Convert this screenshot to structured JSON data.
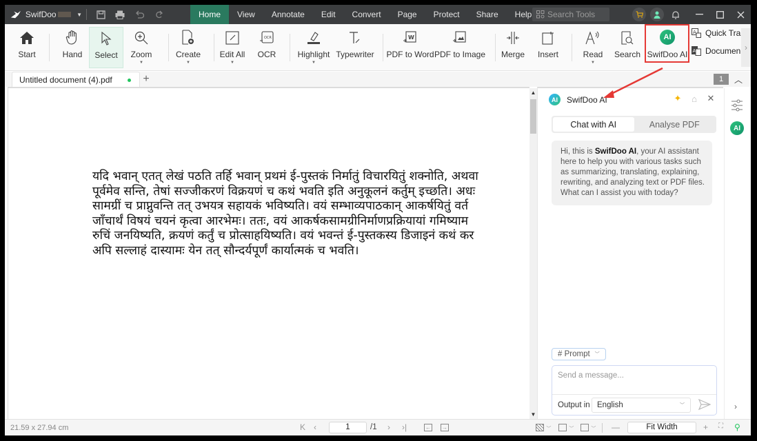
{
  "app": {
    "name": "SwifDoo",
    "colors": {
      "accent": "#2a7a5f",
      "titlebar": "#3b3d3f",
      "highlight_box": "#e53935",
      "ai_green": "#1fa874"
    }
  },
  "menus": [
    {
      "label": "Home",
      "active": true
    },
    {
      "label": "View"
    },
    {
      "label": "Annotate"
    },
    {
      "label": "Edit"
    },
    {
      "label": "Convert"
    },
    {
      "label": "Page"
    },
    {
      "label": "Protect"
    },
    {
      "label": "Share"
    },
    {
      "label": "Help"
    }
  ],
  "search_tools": {
    "placeholder": "Search Tools"
  },
  "ribbon": {
    "start": "Start",
    "hand": "Hand",
    "select": "Select",
    "zoom": "Zoom",
    "create": "Create",
    "edit_all": "Edit All",
    "ocr": "OCR",
    "highlight": "Highlight",
    "typewriter": "Typewriter",
    "pdf_to_word": "PDF to Word",
    "pdf_to_image": "PDF to Image",
    "merge": "Merge",
    "insert": "Insert",
    "read": "Read",
    "search": "Search",
    "swifdoo_ai": "SwifDoo AI",
    "quick_translate": "Quick Trar",
    "document_translate": "Documen"
  },
  "tabs": {
    "document": "Untitled document (4).pdf",
    "page_badge": "1"
  },
  "document": {
    "lines": [
      "यदि भवान् एतत् लेखं पठति तर्हि भवान् प्रथमं ई-पुस्तकं निर्मातुं विचारयितुं शक्नोति, अथवा",
      "पूर्वमेव सन्ति, तेषां सज्जीकरणं विक्रयणं च कथं भवति इति अनुकूलनं कर्तुम् इच्छति। अधः",
      "सामग्रीं च प्राप्नुवन्ति तत् उभयत्र सहायकं भविष्यति। वयं सम्भाव्यपाठकान् आकर्षयितुं वर्त",
      "जाँचार्थं विषयं चयनं कृत्वा आरभेमः। ततः, वयं आकर्षकसामग्रीनिर्माणप्रक्रियायां गमिष्याम",
      "रुचिं जनयिष्यति, क्रयणं कर्तुं च प्रोत्साहयिष्यति। वयं भवन्तं ई-पुस्तकस्य डिजाइनं कथं कर",
      "अपि सल्लाहं दास्यामः येन तत् सौन्दर्यपूर्णं कार्यात्मकं च भवति।"
    ]
  },
  "ai_panel": {
    "title": "SwifDoo AI",
    "avatar": "AI",
    "tabs": [
      {
        "label": "Chat with AI",
        "active": true
      },
      {
        "label": "Analyse PDF"
      }
    ],
    "greeting_prefix": "Hi, this is ",
    "greeting_bold": "SwifDoo AI",
    "greeting_rest": ", your AI assistant here to help you with various tasks such as summarizing, translating, explaining, rewriting, and analyzing text or PDF files. What can I assist you with today?",
    "prompt_chip": "# Prompt",
    "message_placeholder": "Send a message...",
    "output_label": "Output in",
    "output_language": "English"
  },
  "rail": {
    "ai_badge": "AI"
  },
  "statusbar": {
    "page_size": "21.59 x 27.94 cm",
    "current_page": "1",
    "total_pages": "/1",
    "zoom_mode": "Fit Width"
  }
}
